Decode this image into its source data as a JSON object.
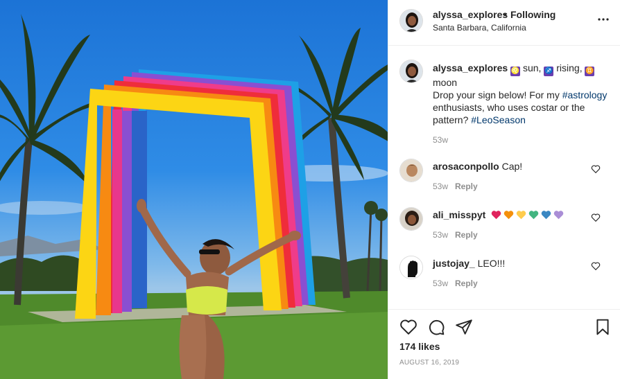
{
  "post": {
    "username": "alyssa_explores",
    "follow_separator": "•",
    "follow_status": "Following",
    "location": "Santa Barbara, California"
  },
  "caption": {
    "username": "alyssa_explores",
    "sign1_icon": "leo-sign-icon",
    "text1": " sun, ",
    "sign2_icon": "sagittarius-sign-icon",
    "text2": " rising, ",
    "sign3_icon": "gemini-sign-icon",
    "text3": " moon",
    "line2a": "Drop your sign below! For my ",
    "hashtag1": "#astrology",
    "line2b": " enthusiasts, who uses costar or the pattern? ",
    "hashtag2": "#LeoSeason",
    "time": "53w"
  },
  "comments": [
    {
      "username": "arosaconpollo",
      "text": "Cap!",
      "time": "53w",
      "reply_label": "Reply"
    },
    {
      "username": "ali_misspyt",
      "text": "",
      "hearts": [
        "#e0245e",
        "#f4900c",
        "#ffcc4d",
        "#43b581",
        "#3b88c3",
        "#aa8ed6"
      ],
      "time": "53w",
      "reply_label": "Reply"
    },
    {
      "username": "justojay_",
      "text": "LEO!!!",
      "time": "53w",
      "reply_label": "Reply"
    }
  ],
  "footer": {
    "likes": "174 likes",
    "date": "AUGUST 16, 2019"
  },
  "colors": {
    "hashtag": "#00376b",
    "muted": "#8e8e8e",
    "text": "#262626"
  }
}
